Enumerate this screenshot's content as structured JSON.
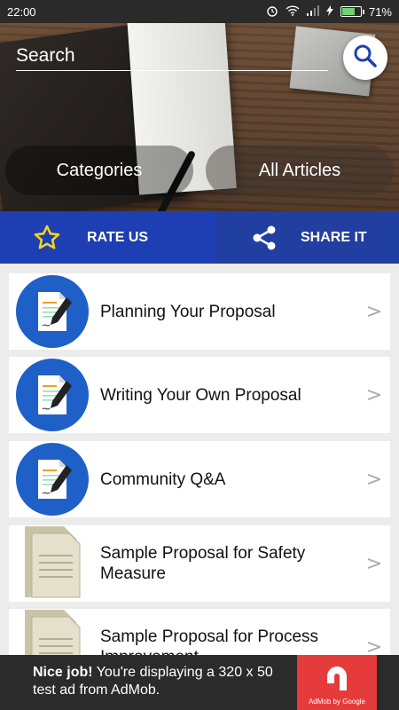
{
  "status_bar": {
    "time": "22:00",
    "battery": "71%",
    "battery_level": 0.71
  },
  "search": {
    "placeholder": "Search"
  },
  "tabs": {
    "categories": "Categories",
    "all_articles": "All Articles"
  },
  "actions": {
    "rate": "RATE US",
    "share": "SHARE IT"
  },
  "list": [
    {
      "title": "Planning Your Proposal",
      "icon": "document-pen-icon"
    },
    {
      "title": "Writing Your Own Proposal",
      "icon": "document-pen-icon"
    },
    {
      "title": "Community Q&A",
      "icon": "document-pen-icon"
    },
    {
      "title": "Sample Proposal for Safety Measure",
      "icon": "paper-stack-icon"
    },
    {
      "title": "Sample Proposal for Process Improvement",
      "icon": "paper-stack-icon"
    }
  ],
  "chevron": ">",
  "ad": {
    "headline": "Nice job!",
    "body": " You're displaying a 320 x 50 test ad from AdMob.",
    "brand": "AdMob by Google"
  },
  "colors": {
    "accent": "#1d3fb3",
    "icon_circle": "#1f5fc8",
    "ad_logo": "#e63b3b"
  }
}
